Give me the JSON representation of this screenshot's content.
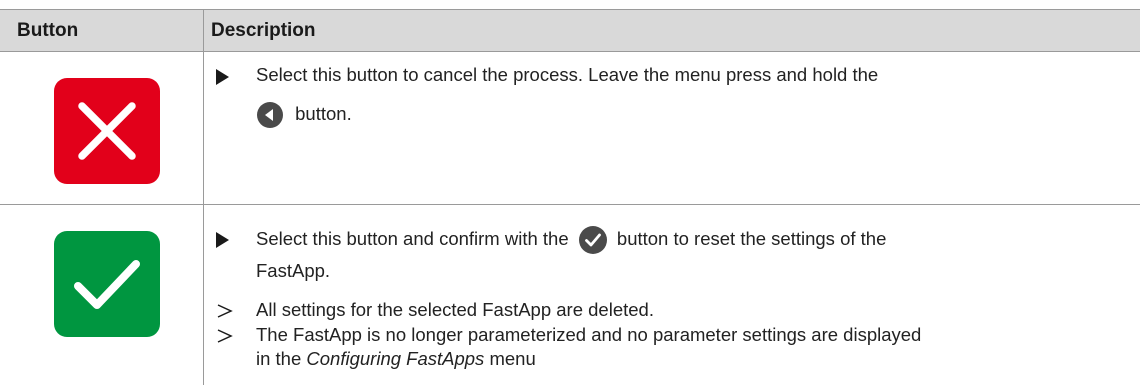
{
  "table": {
    "header": {
      "button": "Button",
      "description": "Description"
    },
    "rows": [
      {
        "icon": "cancel-x-icon",
        "color": "#e2001a",
        "line1": "Select this button to cancel the process. Leave the menu press and hold the",
        "line2": "button."
      },
      {
        "icon": "confirm-check-icon",
        "color": "#009640",
        "line1_a": "Select this button and confirm with the",
        "line1_b": "button to reset the settings of the",
        "line2": "FastApp.",
        "result1": "All settings for the selected FastApp are deleted.",
        "result2": "The FastApp is no longer parameterized and no parameter settings are displayed",
        "result3_a": "in the",
        "result3_italic": "Configuring FastApps",
        "result3_b": "menu"
      }
    ]
  }
}
